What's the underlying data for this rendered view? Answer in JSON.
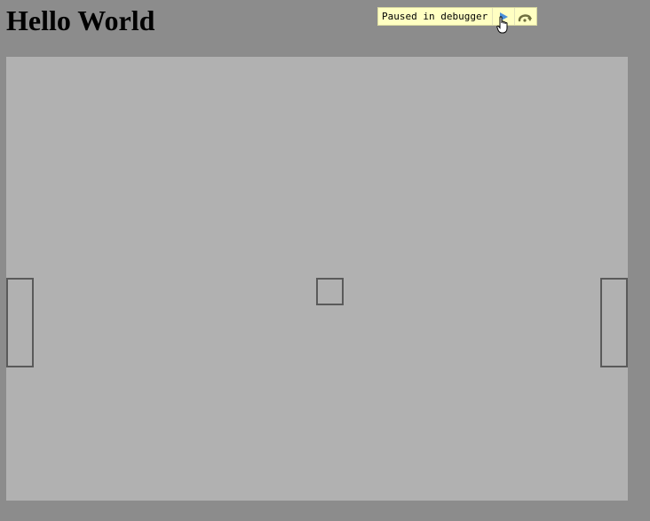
{
  "page": {
    "title": "Hello World",
    "background_color": "#8c8c8c"
  },
  "debugger": {
    "message": "Paused in debugger",
    "resume_icon": "resume-play-icon",
    "step_over_icon": "step-over-icon",
    "background_color": "#ffffc2",
    "resume_color": "#4a90d9",
    "step_over_color": "#6f6f3f"
  },
  "game": {
    "canvas_color": "#b1b1b1",
    "object_stroke_color": "#5a5a5a"
  }
}
